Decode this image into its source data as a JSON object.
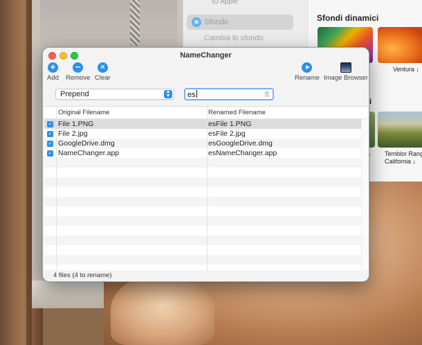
{
  "background_settings": {
    "apple_id_label": "ID Apple",
    "sidebar_selected": "Sfondo",
    "sidebar_next": "Cambia lo sfondo",
    "section_title": "Sfondi dinamici",
    "thumb_labels": [
      "Ventura ↓",
      "Temblor Range\nCalifornia ↓"
    ],
    "cut_text_i": "i",
    "cut_text_a": "a"
  },
  "window": {
    "title": "NameChanger",
    "toolbar": {
      "add": "Add",
      "remove": "Remove",
      "clear": "Clear",
      "rename": "Rename",
      "image_browser": "Image Browser"
    },
    "mode_select": {
      "value": "Prepend"
    },
    "search": {
      "value": "es"
    },
    "table": {
      "columns": [
        "Original Filename",
        "Renamed Filename"
      ],
      "rows": [
        {
          "original": "File 1.PNG",
          "renamed": "esFile 1.PNG",
          "checked": true
        },
        {
          "original": "File 2.jpg",
          "renamed": "esFile 2.jpg",
          "checked": true
        },
        {
          "original": "GoogleDrive.dmg",
          "renamed": "esGoogleDrive.dmg",
          "checked": true
        },
        {
          "original": "NameChanger.app",
          "renamed": "esNameChanger.app",
          "checked": true
        }
      ]
    },
    "status": "4 files (4 to rename)"
  },
  "colors": {
    "accent": "#2a8ff0",
    "close": "#fe5f57",
    "minimize": "#febc2e",
    "zoom": "#28c840"
  }
}
